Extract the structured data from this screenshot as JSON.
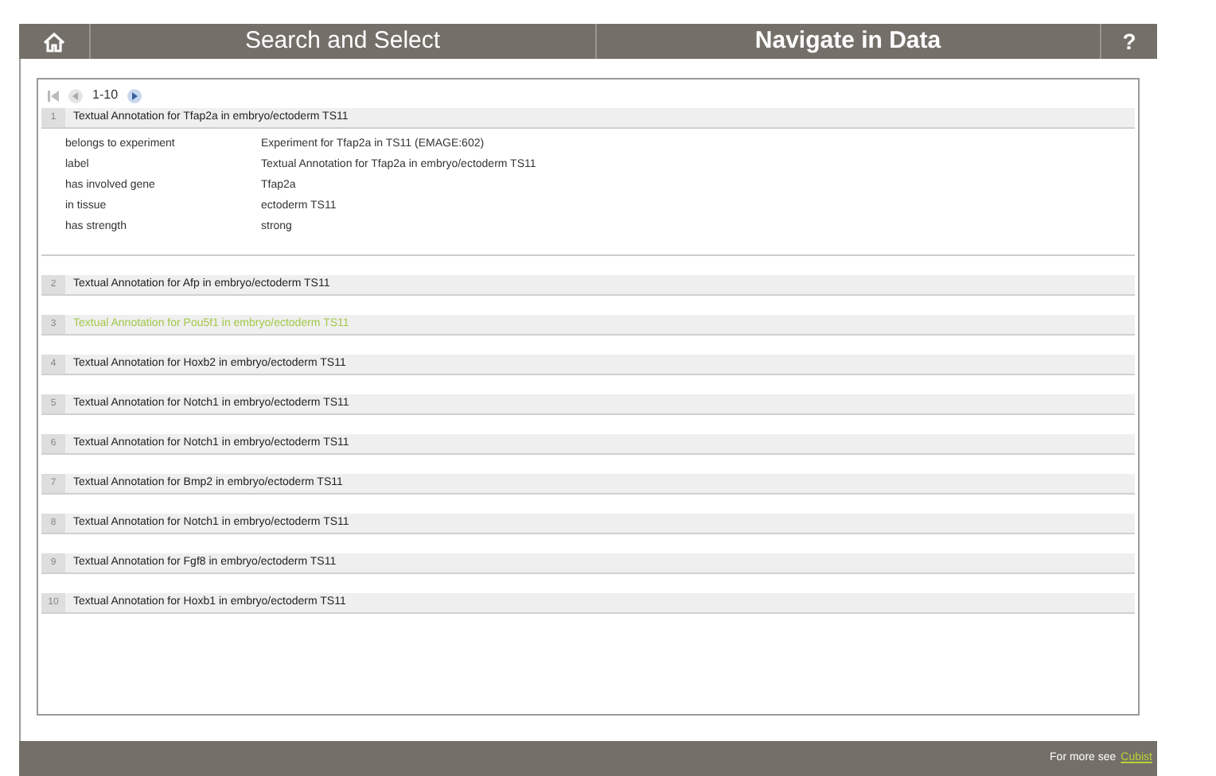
{
  "header": {
    "tabs": [
      {
        "label": "Search and Select",
        "selected": false
      },
      {
        "label": "Navigate in Data",
        "selected": true
      }
    ],
    "help": "?"
  },
  "pager": {
    "range": "1-10"
  },
  "results": [
    {
      "number": "1",
      "title": "Textual Annotation for Tfap2a in embryo/ectoderm TS11",
      "highlighted": false,
      "details": [
        {
          "property": "belongs to experiment",
          "value": "Experiment for Tfap2a in TS11 (EMAGE:602)"
        },
        {
          "property": "label",
          "value": "Textual Annotation for Tfap2a in embryo/ectoderm TS11"
        },
        {
          "property": "has involved gene",
          "value": "Tfap2a"
        },
        {
          "property": "in tissue",
          "value": "ectoderm TS11"
        },
        {
          "property": "has strength",
          "value": "strong"
        }
      ]
    },
    {
      "number": "2",
      "title": "Textual Annotation for Afp in embryo/ectoderm TS11",
      "highlighted": false
    },
    {
      "number": "3",
      "title": "Textual Annotation for Pou5f1 in embryo/ectoderm TS11",
      "highlighted": true
    },
    {
      "number": "4",
      "title": "Textual Annotation for Hoxb2 in embryo/ectoderm TS11",
      "highlighted": false
    },
    {
      "number": "5",
      "title": "Textual Annotation for Notch1 in embryo/ectoderm TS11",
      "highlighted": false
    },
    {
      "number": "6",
      "title": "Textual Annotation for Notch1 in embryo/ectoderm TS11",
      "highlighted": false
    },
    {
      "number": "7",
      "title": "Textual Annotation for Bmp2 in embryo/ectoderm TS11",
      "highlighted": false
    },
    {
      "number": "8",
      "title": "Textual Annotation for Notch1 in embryo/ectoderm TS11",
      "highlighted": false
    },
    {
      "number": "9",
      "title": "Textual Annotation for Fgf8 in embryo/ectoderm TS11",
      "highlighted": false
    },
    {
      "number": "10",
      "title": "Textual Annotation for Hoxb1 in embryo/ectoderm TS11",
      "highlighted": false
    }
  ],
  "footer": {
    "text": "For more see",
    "link": "Cubist"
  }
}
